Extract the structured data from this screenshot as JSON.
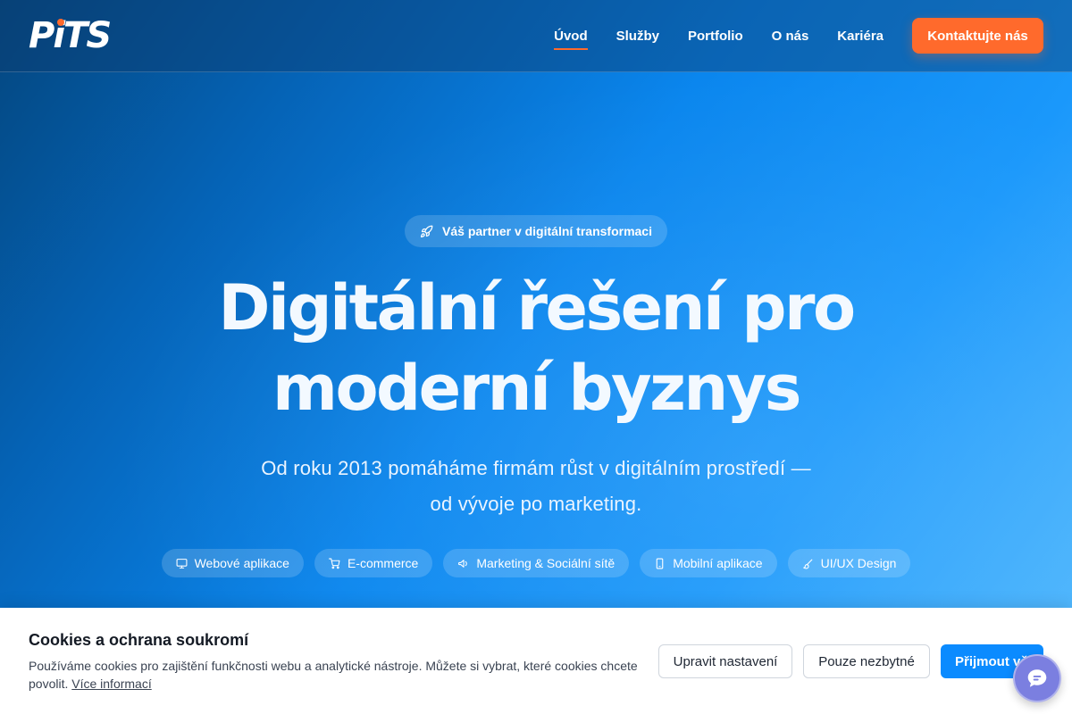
{
  "brand": {
    "logo_text": "PiTS",
    "accent": "#ff6a2c",
    "primary": "#0b8bff"
  },
  "nav": {
    "items": [
      {
        "label": "Úvod",
        "active": true
      },
      {
        "label": "Služby"
      },
      {
        "label": "Portfolio"
      },
      {
        "label": "O nás"
      },
      {
        "label": "Kariéra"
      }
    ],
    "cta_label": "Kontaktujte nás"
  },
  "hero": {
    "badge": {
      "icon": "rocket-icon",
      "text": "Váš partner v digitální transformaci"
    },
    "title_line1": "Digitální řešení pro",
    "title_line2": "moderní byznys",
    "subtitle_line1": "Od roku 2013 pomáháme firmám růst v digitálním prostředí —",
    "subtitle_line2": "od vývoje po marketing.",
    "pills": [
      {
        "icon": "monitor-icon",
        "label": "Webové aplikace"
      },
      {
        "icon": "cart-icon",
        "label": "E-commerce"
      },
      {
        "icon": "megaphone-icon",
        "label": "Marketing & Sociální sítě"
      },
      {
        "icon": "phone-icon",
        "label": "Mobilní aplikace"
      },
      {
        "icon": "brush-icon",
        "label": "UI/UX Design"
      }
    ]
  },
  "cookie": {
    "title": "Cookies a ochrana soukromí",
    "text": "Používáme cookies pro zajištění funkčnosti webu a analytické nástroje. Můžete si vybrat, které cookies chcete povolit.",
    "more_link": "Více informací",
    "buttons": {
      "settings": "Upravit nastavení",
      "necessary": "Pouze nezbytné",
      "accept": "Přijmout vše"
    }
  },
  "chat": {
    "icon": "chat-icon"
  }
}
